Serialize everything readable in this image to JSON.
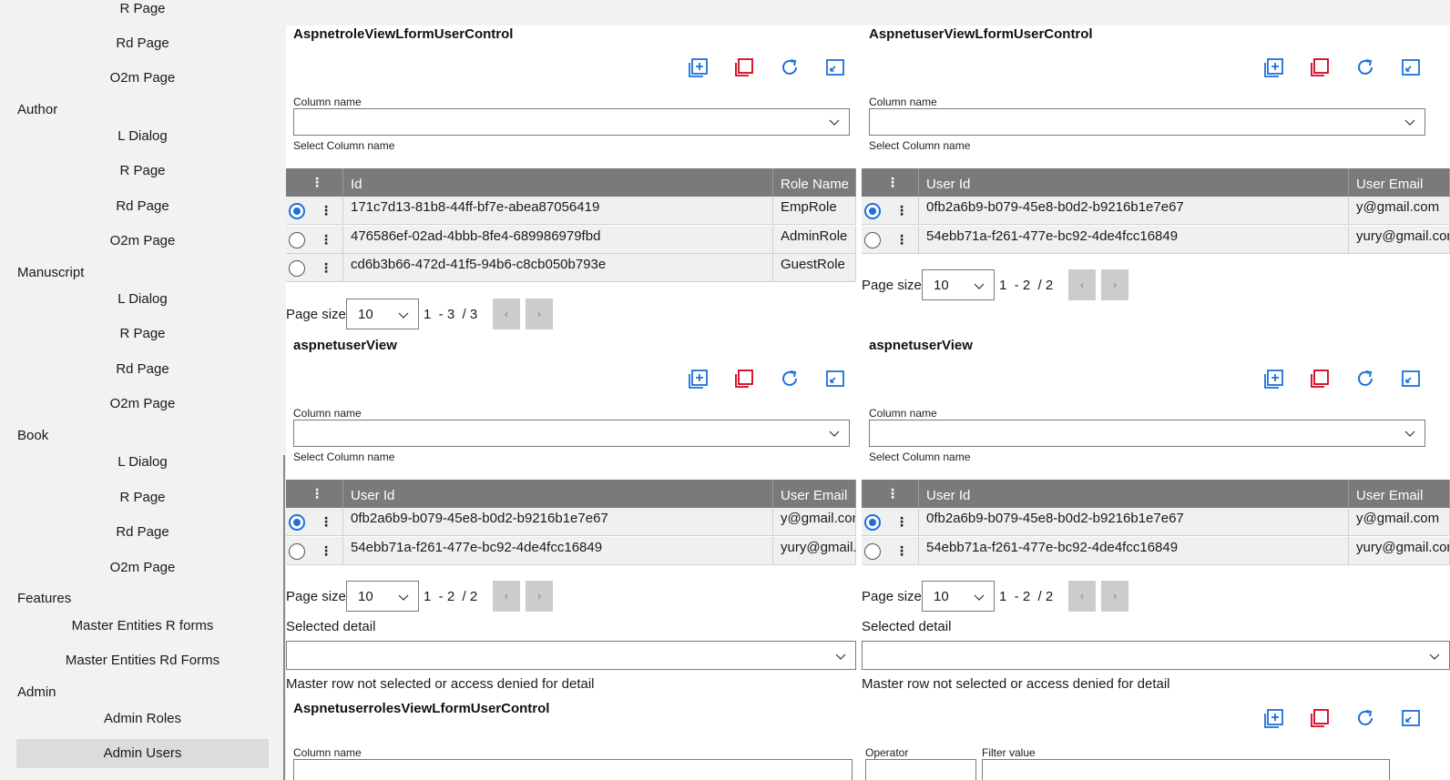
{
  "sidebar": {
    "entries": [
      {
        "kind": "item",
        "label": "R Page"
      },
      {
        "kind": "item",
        "label": "Rd Page"
      },
      {
        "kind": "item",
        "label": "O2m Page"
      },
      {
        "kind": "group",
        "label": "Author"
      },
      {
        "kind": "item",
        "label": "L Dialog"
      },
      {
        "kind": "item",
        "label": "R Page"
      },
      {
        "kind": "item",
        "label": "Rd Page"
      },
      {
        "kind": "item",
        "label": "O2m Page"
      },
      {
        "kind": "group",
        "label": "Manuscript"
      },
      {
        "kind": "item",
        "label": "L Dialog"
      },
      {
        "kind": "item",
        "label": "R Page"
      },
      {
        "kind": "item",
        "label": "Rd Page"
      },
      {
        "kind": "item",
        "label": "O2m Page"
      },
      {
        "kind": "group",
        "label": "Book"
      },
      {
        "kind": "item",
        "label": "L Dialog"
      },
      {
        "kind": "item",
        "label": "R Page"
      },
      {
        "kind": "item",
        "label": "Rd Page"
      },
      {
        "kind": "item",
        "label": "O2m Page"
      },
      {
        "kind": "group",
        "label": "Features"
      },
      {
        "kind": "item",
        "label": "Master Entities R forms"
      },
      {
        "kind": "item",
        "label": "Master Entities Rd Forms"
      },
      {
        "kind": "group",
        "label": "Admin"
      },
      {
        "kind": "item",
        "label": "Admin Roles"
      },
      {
        "kind": "item",
        "label": "Admin Users",
        "selected": true
      }
    ]
  },
  "common": {
    "column_name_label": "Column name",
    "column_name_hint": "Select Column name",
    "page_size_label": "Page size",
    "page_size_value": "10",
    "selected_detail_label": "Selected detail",
    "master_msg": "Master row not selected or access denied for detail",
    "operator_label": "Operator",
    "filter_value_label": "Filter value",
    "prev_glyph": "‹",
    "next_glyph": "›"
  },
  "panels": [
    {
      "title": "AspnetroleViewLformUserControl",
      "columns": [
        "Id",
        "Role Name"
      ],
      "rows": [
        {
          "selected": true,
          "c1": "171c7d13-81b8-44ff-bf7e-abea87056419",
          "c2": "EmpRole"
        },
        {
          "selected": false,
          "c1": "476586ef-02ad-4bbb-8fe4-689986979fbd",
          "c2": "AdminRole"
        },
        {
          "selected": false,
          "c1": "cd6b3b66-472d-41f5-94b6-c8cb050b793e",
          "c2": "GuestRole"
        }
      ],
      "range": "1  - 3  / 3"
    },
    {
      "title": "AspnetuserViewLformUserControl",
      "columns": [
        "User Id",
        "User Email"
      ],
      "rows": [
        {
          "selected": true,
          "c1": "0fb2a6b9-b079-45e8-b0d2-b9216b1e7e67",
          "c2": "y@gmail.com"
        },
        {
          "selected": false,
          "c1": "54ebb71a-f261-477e-bc92-4de4fcc16849",
          "c2": "yury@gmail.com"
        }
      ],
      "range": "1  - 2  / 2"
    },
    {
      "title": "aspnetuserView",
      "columns": [
        "User Id",
        "User Email"
      ],
      "rows": [
        {
          "selected": true,
          "c1": "0fb2a6b9-b079-45e8-b0d2-b9216b1e7e67",
          "c2": "y@gmail.com"
        },
        {
          "selected": false,
          "c1": "54ebb71a-f261-477e-bc92-4de4fcc16849",
          "c2": "yury@gmail.com"
        }
      ],
      "range": "1  - 2  / 2"
    },
    {
      "title": "aspnetuserView",
      "columns": [
        "User Id",
        "User Email"
      ],
      "rows": [
        {
          "selected": true,
          "c1": "0fb2a6b9-b079-45e8-b0d2-b9216b1e7e67",
          "c2": "y@gmail.com"
        },
        {
          "selected": false,
          "c1": "54ebb71a-f261-477e-bc92-4de4fcc16849",
          "c2": "yury@gmail.com"
        }
      ],
      "range": "1  - 2  / 2"
    }
  ],
  "bottom_panel": {
    "title": "AspnetuserrolesViewLformUserControl"
  },
  "icons": {
    "toolbar": [
      "add-icon",
      "copy-icon",
      "refresh-icon",
      "expand-icon"
    ],
    "accent": "#1e6fd9",
    "danger": "#d0021b"
  }
}
